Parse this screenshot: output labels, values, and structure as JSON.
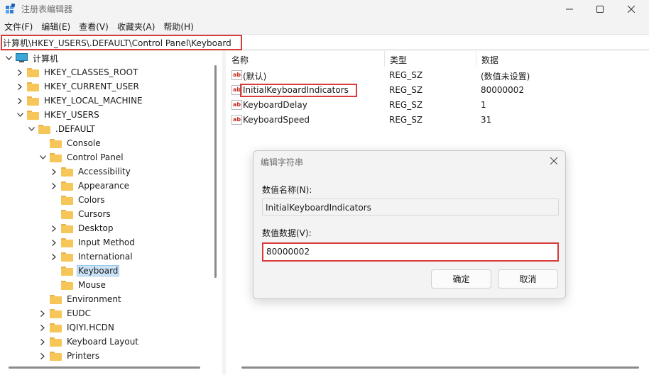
{
  "window": {
    "title": "注册表编辑器",
    "icon": "regedit-icon"
  },
  "menu": [
    "文件(F)",
    "编辑(E)",
    "查看(V)",
    "收藏夹(A)",
    "帮助(H)"
  ],
  "address": "计算机\\HKEY_USERS\\.DEFAULT\\Control Panel\\Keyboard",
  "tree": {
    "root": "计算机",
    "items": [
      {
        "label": "HKEY_CLASSES_ROOT",
        "expanded": false
      },
      {
        "label": "HKEY_CURRENT_USER",
        "expanded": false
      },
      {
        "label": "HKEY_LOCAL_MACHINE",
        "expanded": false
      },
      {
        "label": "HKEY_USERS",
        "expanded": true
      },
      {
        "label": ".DEFAULT",
        "expanded": true
      },
      {
        "label": "Console",
        "expanded": null
      },
      {
        "label": "Control Panel",
        "expanded": true
      },
      {
        "label": "Accessibility",
        "expanded": false
      },
      {
        "label": "Appearance",
        "expanded": false
      },
      {
        "label": "Colors",
        "expanded": null
      },
      {
        "label": "Cursors",
        "expanded": null
      },
      {
        "label": "Desktop",
        "expanded": false
      },
      {
        "label": "Input Method",
        "expanded": false
      },
      {
        "label": "International",
        "expanded": false
      },
      {
        "label": "Keyboard",
        "expanded": null,
        "selected": true
      },
      {
        "label": "Mouse",
        "expanded": null
      },
      {
        "label": "Environment",
        "expanded": null
      },
      {
        "label": "EUDC",
        "expanded": false
      },
      {
        "label": "IQIYI.HCDN",
        "expanded": false
      },
      {
        "label": "Keyboard Layout",
        "expanded": false
      },
      {
        "label": "Printers",
        "expanded": false
      }
    ]
  },
  "values": {
    "headers": {
      "name": "名称",
      "type": "类型",
      "data": "数据"
    },
    "rows": [
      {
        "name": "(默认)",
        "type": "REG_SZ",
        "data": "(数值未设置)"
      },
      {
        "name": "InitialKeyboardIndicators",
        "type": "REG_SZ",
        "data": "80000002"
      },
      {
        "name": "KeyboardDelay",
        "type": "REG_SZ",
        "data": "1"
      },
      {
        "name": "KeyboardSpeed",
        "type": "REG_SZ",
        "data": "31"
      }
    ],
    "icon_text": "ab"
  },
  "dialog": {
    "title": "编辑字符串",
    "name_label": "数值名称(N):",
    "name_value": "InitialKeyboardIndicators",
    "data_label": "数值数据(V):",
    "data_value": "80000002",
    "ok_label": "确定",
    "cancel_label": "取消"
  },
  "colors": {
    "highlight": "#d83b3b",
    "selection": "#cce4f7",
    "folder": "#f6c758"
  }
}
